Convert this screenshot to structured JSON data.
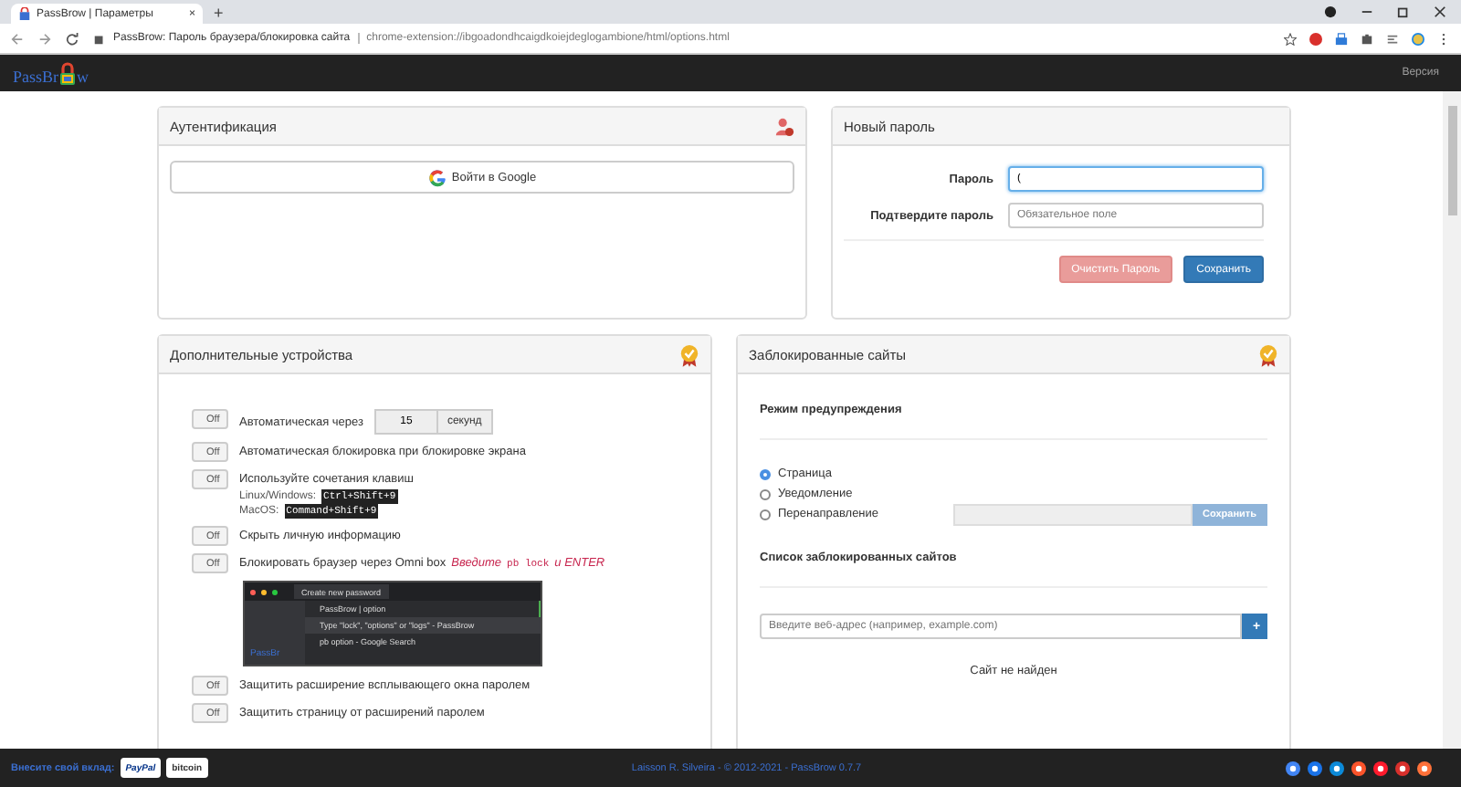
{
  "browser": {
    "tab": {
      "title": "PassBrow | Параметры",
      "close": "×"
    },
    "new_tab": "+",
    "address": {
      "site_title": "PassBrow: Пароль браузера/блокировка сайта",
      "url": "chrome-extension://ibgoadondhcaigdkoiejdeglogambione/html/options.html"
    }
  },
  "navbar": {
    "logo_start": "PassBr",
    "logo_end": "w",
    "version_link": "Версия"
  },
  "auth": {
    "title": "Аутентификация",
    "google_button": "Войти в Google"
  },
  "new_password": {
    "title": "Новый пароль",
    "fields": [
      {
        "label": "Пароль",
        "value": "(",
        "focused": true
      },
      {
        "label": "Подтвердите пароль",
        "placeholder": "Обязательное поле",
        "focused": false
      }
    ],
    "buttons": [
      {
        "label": "Очистить Пароль",
        "kind": "danger"
      },
      {
        "label": "Сохранить",
        "kind": "primary"
      }
    ]
  },
  "devices": {
    "title": "Дополнительные устройства",
    "options": [
      {
        "kind": "timer",
        "toggle": "Off",
        "on": false,
        "label": "Автоматическая через",
        "value": "15",
        "unit": "секунд"
      },
      {
        "kind": "plain",
        "toggle": "Off",
        "on": false,
        "label": "Автоматическая блокировка при блокировке экрана"
      },
      {
        "kind": "shortcuts",
        "toggle": "Off",
        "on": false,
        "label": "Используйте сочетания клавиш",
        "shortcuts": [
          {
            "os": "Linux/Windows:",
            "keys": "Ctrl+Shift+9"
          },
          {
            "os": "MacOS:",
            "keys": "Command+Shift+9"
          }
        ]
      },
      {
        "kind": "plain",
        "toggle": "Off",
        "on": false,
        "label": "Скрыть личную информацию"
      },
      {
        "kind": "omnibox",
        "toggle": "Off",
        "on": false,
        "label": "Блокировать браузер через Omni box",
        "hint_before": "Введите",
        "hint_code": "pb lock",
        "hint_after": "и ENTER",
        "screenshot": {
          "tab": "Create new password",
          "omnibox": "PassBrow | option",
          "logo": "PassBr",
          "suggestions": [
            "Type \"lock\", \"options\" or \"logs\" - PassBrow",
            "pb option - Google Search"
          ]
        }
      },
      {
        "kind": "plain",
        "toggle": "Off",
        "on": false,
        "label": "Защитить расширение всплывающего окна паролем"
      },
      {
        "kind": "plain",
        "toggle": "Off",
        "on": false,
        "label": "Защитить страницу от расширений паролем"
      }
    ]
  },
  "blocked": {
    "title": "Заблокированные сайты",
    "mode_heading": "Режим предупреждения",
    "modes": [
      {
        "label": "Страница",
        "selected": true
      },
      {
        "label": "Уведомление",
        "selected": false
      },
      {
        "label": "Перенаправление",
        "selected": false
      }
    ],
    "redirect_field": {
      "disabled": true
    },
    "redirect_button": "Сохранить",
    "list_heading": "Список заблокированных сайтов",
    "url_field": {
      "placeholder": "Введите веб-адрес (например, example.com)"
    },
    "add_button": "+",
    "empty": "Сайт не найден"
  },
  "footer": {
    "donate_label": "Внесите свой вклад:",
    "donate_buttons": [
      "PayPal",
      "bitcoin"
    ],
    "credits": "Laisson R. Silveira - © 2012-2021 - PassBrow 0.7.7"
  }
}
